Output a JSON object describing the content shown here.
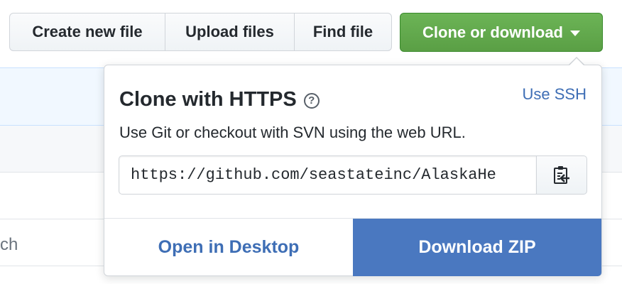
{
  "toolbar": {
    "create_label": "Create new file",
    "upload_label": "Upload files",
    "find_label": "Find file",
    "clone_label": "Clone or download"
  },
  "background": {
    "search_fragment": "ch"
  },
  "popover": {
    "title": "Clone with HTTPS",
    "help_glyph": "?",
    "use_ssh_label": "Use SSH",
    "description": "Use Git or checkout with SVN using the web URL.",
    "url_value": "https://github.com/seastateinc/AlaskaHe",
    "copy_icon": "clipboard-icon",
    "open_desktop_label": "Open in Desktop",
    "download_zip_label": "Download ZIP"
  },
  "colors": {
    "accent_green": "#5a9f45",
    "link_blue": "#3e6eb5",
    "download_blue": "#4a78c0"
  }
}
